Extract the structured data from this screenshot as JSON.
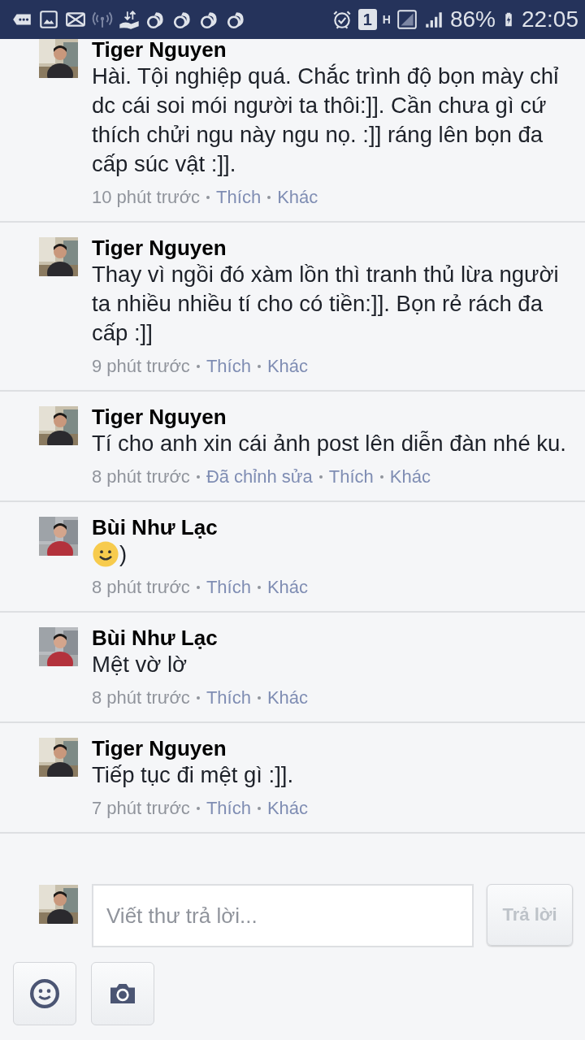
{
  "status_bar": {
    "sim_badge": "1",
    "network_type": "H",
    "battery": "86%",
    "time": "22:05"
  },
  "comments": [
    {
      "author": "Tiger Nguyen",
      "kind": "text",
      "text": "Hài. Tội nghiệp quá. Chắc trình độ bọn mày chỉ dc cái soi mói người ta thôi:]]. Cần chưa gì cứ thích chửi ngu này ngu nọ. :]] ráng lên bọn đa cấp súc vật :]].",
      "time": "10 phút trước",
      "actions": [
        "Thích",
        "Khác"
      ]
    },
    {
      "author": "Tiger Nguyen",
      "kind": "text",
      "text": "Thay vì ngồi đó xàm lồn thì tranh thủ lừa người ta nhiều nhiều tí cho có tiền:]]. Bọn rẻ rách đa cấp :]]",
      "time": "9 phút trước",
      "actions": [
        "Thích",
        "Khác"
      ]
    },
    {
      "author": "Tiger Nguyen",
      "kind": "text",
      "text": "Tí cho anh xin cái ảnh post lên diễn đàn nhé ku.",
      "time": "8 phút trước",
      "actions": [
        "Đã chỉnh sửa",
        "Thích",
        "Khác"
      ]
    },
    {
      "author": "Bùi Như Lạc",
      "kind": "emoji_text",
      "text": ")",
      "time": "8 phút trước",
      "actions": [
        "Thích",
        "Khác"
      ]
    },
    {
      "author": "Bùi Như Lạc",
      "kind": "text",
      "text": "Mệt vờ lờ",
      "time": "8 phút trước",
      "actions": [
        "Thích",
        "Khác"
      ]
    },
    {
      "author": "Tiger Nguyen",
      "kind": "text",
      "text": "Tiếp tục đi mệt gì :]].",
      "time": "7 phút trước",
      "actions": [
        "Thích",
        "Khác"
      ]
    }
  ],
  "reply": {
    "placeholder": "Viết thư trả lời...",
    "button": "Trả lời",
    "disabled": true
  }
}
